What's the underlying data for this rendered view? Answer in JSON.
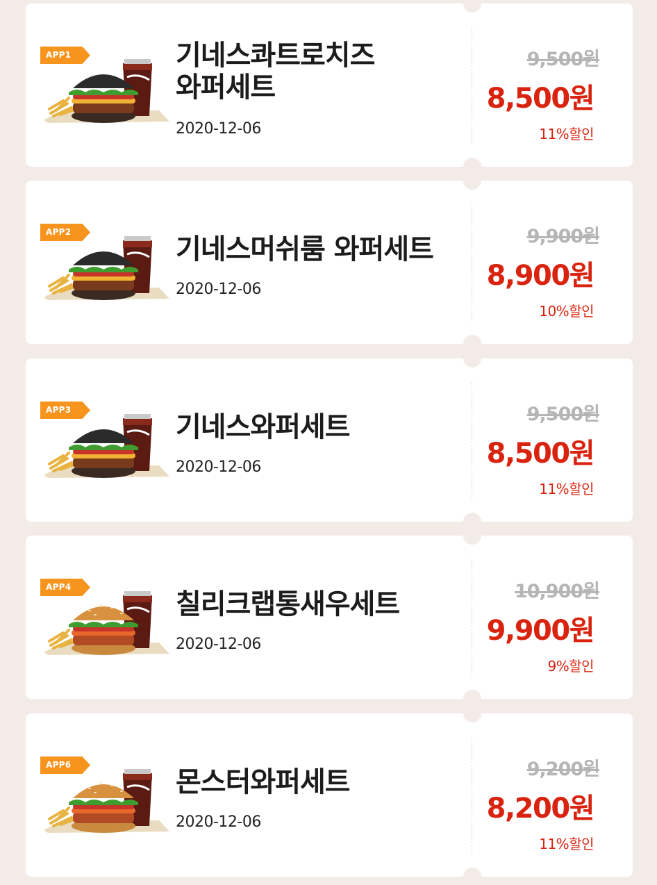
{
  "colors": {
    "background": "#f3ebe7",
    "card": "#ffffff",
    "tag": "#f7941d",
    "sale_price": "#d9230f",
    "original_price": "#b5b5b5"
  },
  "coupons": [
    {
      "tag": "APP1",
      "title_line1": "기네스콰트로치즈",
      "title_line2": "와퍼세트",
      "date": "2020-12-06",
      "original_price": "9,500원",
      "sale_price": "8,500원",
      "discount": "11%할인",
      "image": "black-bun-burger-set-photo"
    },
    {
      "tag": "APP2",
      "title_line1": "기네스머쉬룸 와퍼세트",
      "title_line2": "",
      "date": "2020-12-06",
      "original_price": "9,900원",
      "sale_price": "8,900원",
      "discount": "10%할인",
      "image": "black-bun-burger-set-photo"
    },
    {
      "tag": "APP3",
      "title_line1": "기네스와퍼세트",
      "title_line2": "",
      "date": "2020-12-06",
      "original_price": "9,500원",
      "sale_price": "8,500원",
      "discount": "11%할인",
      "image": "black-bun-burger-set-photo"
    },
    {
      "tag": "APP4",
      "title_line1": "칠리크랩통새우세트",
      "title_line2": "",
      "date": "2020-12-06",
      "original_price": "10,900원",
      "sale_price": "9,900원",
      "discount": "9%할인",
      "image": "sesame-bun-burger-set-photo"
    },
    {
      "tag": "APP6",
      "title_line1": "몬스터와퍼세트",
      "title_line2": "",
      "date": "2020-12-06",
      "original_price": "9,200원",
      "sale_price": "8,200원",
      "discount": "11%할인",
      "image": "sesame-bun-burger-set-photo"
    }
  ]
}
